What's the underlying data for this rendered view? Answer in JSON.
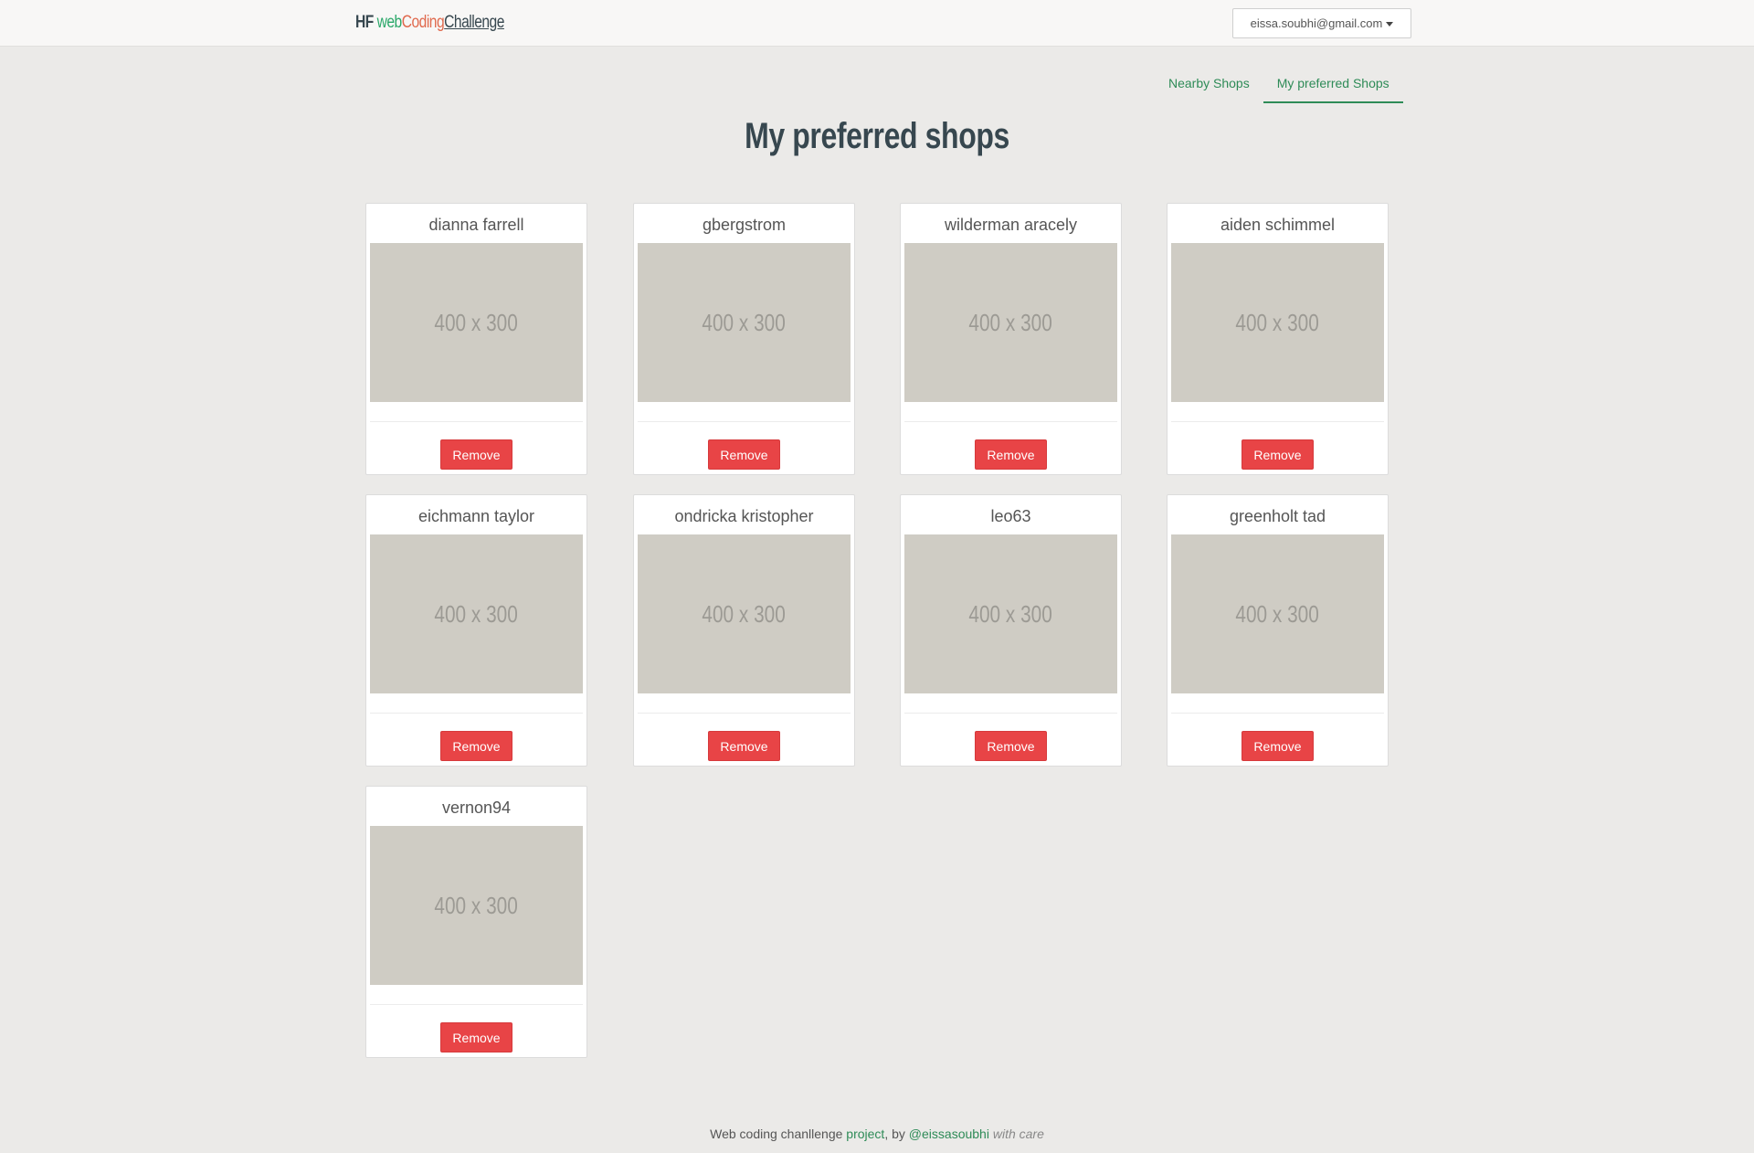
{
  "brand": {
    "part1": "HF ",
    "part2": "web",
    "part3": "Coding",
    "part4": "Challenge"
  },
  "user": {
    "email": "eissa.soubhi@gmail.com"
  },
  "tabs": [
    {
      "label": "Nearby Shops",
      "active": false
    },
    {
      "label": "My preferred Shops",
      "active": true
    }
  ],
  "page": {
    "title": "My preferred shops"
  },
  "placeholder_text": "400 x 300",
  "remove_label": "Remove",
  "shops": [
    {
      "name": "dianna farrell"
    },
    {
      "name": "gbergstrom"
    },
    {
      "name": "wilderman aracely"
    },
    {
      "name": "aiden schimmel"
    },
    {
      "name": "eichmann taylor"
    },
    {
      "name": "ondricka kristopher"
    },
    {
      "name": "leo63"
    },
    {
      "name": "greenholt tad"
    },
    {
      "name": "vernon94"
    }
  ],
  "footer": {
    "text1": "Web coding chanllenge ",
    "link1": "project",
    "text2": ", by ",
    "link2": "@eissasoubhi",
    "text3": " ",
    "care": "with care"
  },
  "colors": {
    "accent": "#2e8b57",
    "danger": "#e84446",
    "background": "#ebeae8",
    "placeholder": "#cfccc4"
  }
}
